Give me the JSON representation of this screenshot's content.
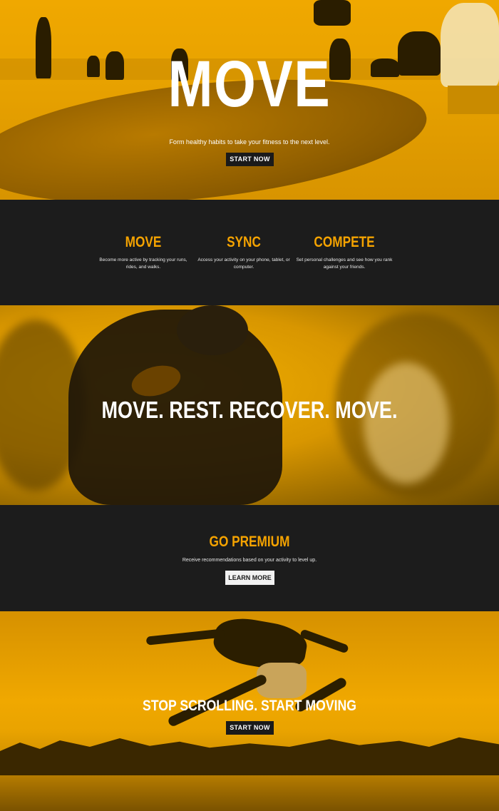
{
  "hero": {
    "title": "MOVE",
    "subtitle": "Form healthy habits to take your fitness to the next level.",
    "button": "START NOW"
  },
  "features": [
    {
      "title": "MOVE",
      "text": "Become more active by tracking your runs, rides, and walks."
    },
    {
      "title": "SYNC",
      "text": "Access your activity on your phone, tablet, or computer."
    },
    {
      "title": "COMPETE",
      "text": "Set personal challenges and see how you rank against your friends."
    }
  ],
  "banner": {
    "title": "MOVE. REST. RECOVER. MOVE."
  },
  "premium": {
    "title": "GO PREMIUM",
    "subtitle": "Receive recommendations based on your activity to level up.",
    "button": "LEARN MORE"
  },
  "cta": {
    "title": "STOP SCROLLING. START MOVING",
    "button": "START NOW"
  },
  "colors": {
    "accent": "#f5a300",
    "dark": "#1c1c1c",
    "overlay": "#f0a800"
  }
}
